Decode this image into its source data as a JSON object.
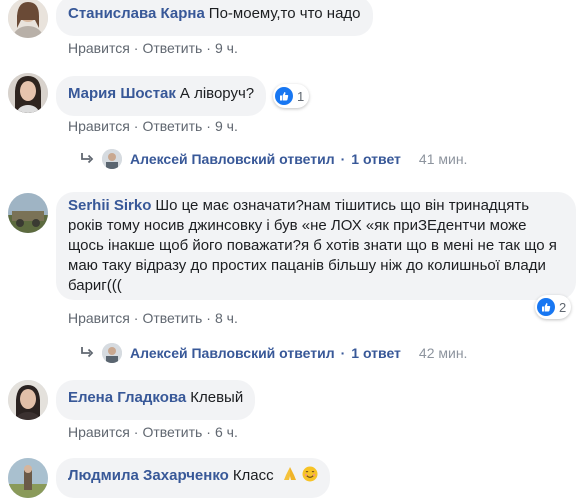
{
  "comments": [
    {
      "author": "Станислава Карна",
      "text": "По-моему,то что надо",
      "like": "Нравится",
      "reply": "Ответить",
      "time": "9 ч."
    },
    {
      "author": "Мария Шостак",
      "text": "А ліворуч?",
      "reactions": "1",
      "like": "Нравится",
      "reply": "Ответить",
      "time": "9 ч."
    },
    {
      "author": "Serhii Sirko",
      "text": "Шо це має означати?нам тішитись що він тринадцять років тому носив джинсовку і був «не ЛОХ «як приЗЕдентчи може щось інакше щоб його поважати?я б хотів знати що в мені не так що я маю таку відразу до простих пацанів більшу ніж до колишньої влади бариг(((",
      "reactions": "2",
      "like": "Нравится",
      "reply": "Ответить",
      "time": "8 ч."
    },
    {
      "author": "Елена Гладкова",
      "text": "Клевый",
      "like": "Нравится",
      "reply": "Ответить",
      "time": "6 ч."
    },
    {
      "author": "Людмила Захарченко",
      "text": "Класс"
    }
  ],
  "reply_threads": [
    {
      "name": "Алексей Павловский ответил",
      "count": "1 ответ",
      "time": "41 мин."
    },
    {
      "name": "Алексей Павловский ответил",
      "count": "1 ответ",
      "time": "42 мин."
    }
  ],
  "colors": {
    "link": "#385898",
    "meta": "#606770",
    "bubble": "#f2f3f5",
    "like": "#1877f2"
  },
  "icons": [
    "thumbs-up-icon",
    "reply-arrow-icon",
    "folded-hands-emoji",
    "smiling-face-emoji"
  ]
}
